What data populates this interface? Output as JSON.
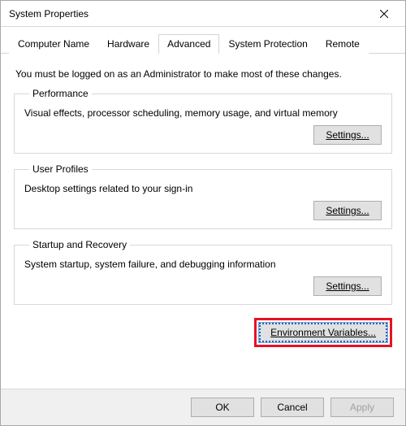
{
  "window": {
    "title": "System Properties"
  },
  "tabs": {
    "computerName": "Computer Name",
    "hardware": "Hardware",
    "advanced": "Advanced",
    "systemProtection": "System Protection",
    "remote": "Remote"
  },
  "intro": "You must be logged on as an Administrator to make most of these changes.",
  "performance": {
    "legend": "Performance",
    "desc": "Visual effects, processor scheduling, memory usage, and virtual memory",
    "button": "Settings..."
  },
  "userProfiles": {
    "legend": "User Profiles",
    "desc": "Desktop settings related to your sign-in",
    "button": "Settings..."
  },
  "startup": {
    "legend": "Startup and Recovery",
    "desc": "System startup, system failure, and debugging information",
    "button": "Settings..."
  },
  "envButton": "Environment Variables...",
  "footer": {
    "ok": "OK",
    "cancel": "Cancel",
    "apply": "Apply"
  }
}
